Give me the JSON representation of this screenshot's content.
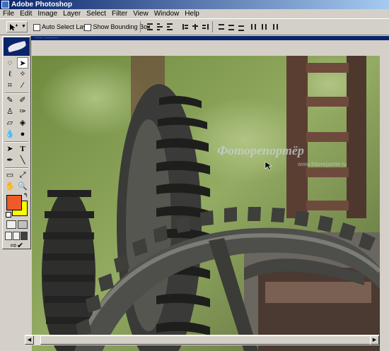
{
  "app": {
    "title": "Adobe Photoshop"
  },
  "menu": [
    "File",
    "Edit",
    "Image",
    "Layer",
    "Select",
    "Filter",
    "View",
    "Window",
    "Help"
  ],
  "options": {
    "auto_select_label": "Auto Select Layer",
    "bounding_box_label": "Show Bounding Box"
  },
  "document": {
    "title": "...... ..........",
    "watermark_main": "Фоторепортёр",
    "watermark_url": "www.fotoreporter.ru"
  },
  "colors": {
    "foreground": "#ee5a28",
    "background": "#ffff00",
    "title_active": "#0a246a",
    "chrome": "#d4d0c8"
  },
  "tools": [
    "marquee-icon",
    "move-icon",
    "lasso-icon",
    "magic-wand-icon",
    "crop-icon",
    "slice-icon",
    "healing-brush-icon",
    "brush-icon",
    "clone-stamp-icon",
    "history-brush-icon",
    "eraser-icon",
    "gradient-icon",
    "blur-icon",
    "dodge-icon",
    "path-select-icon",
    "type-icon",
    "pen-icon",
    "line-icon",
    "notes-icon",
    "eyedropper-icon",
    "hand-icon",
    "zoom-icon"
  ]
}
